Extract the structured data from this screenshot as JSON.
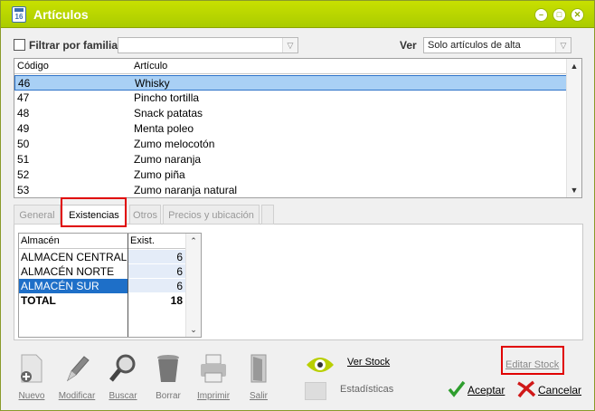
{
  "window": {
    "title": "Artículos",
    "icon_label": "16"
  },
  "filter": {
    "checkbox_label": "Filtrar por familia",
    "family_value": "",
    "ver_label": "Ver",
    "ver_value": "Solo artículos de alta"
  },
  "grid": {
    "headers": [
      "Código",
      "Artículo"
    ],
    "rows": [
      {
        "code": "46",
        "name": "Whisky"
      },
      {
        "code": "47",
        "name": "Pincho tortilla"
      },
      {
        "code": "48",
        "name": "Snack patatas"
      },
      {
        "code": "49",
        "name": "Menta poleo"
      },
      {
        "code": "50",
        "name": "Zumo melocotón"
      },
      {
        "code": "51",
        "name": "Zumo naranja"
      },
      {
        "code": "52",
        "name": "Zumo piña"
      },
      {
        "code": "53",
        "name": "Zumo naranja natural"
      }
    ],
    "selected_index": 0
  },
  "tabs": [
    "General",
    "Existencias",
    "Otros",
    "Precios y ubicación"
  ],
  "active_tab": 1,
  "stock": {
    "headers": [
      "Almacén",
      "Exist."
    ],
    "rows": [
      {
        "name": "ALMACEN CENTRAL",
        "qty": "6"
      },
      {
        "name": "ALMACÉN NORTE",
        "qty": "6"
      },
      {
        "name": "ALMACÉN SUR",
        "qty": "6"
      }
    ],
    "total_label": "TOTAL",
    "total_value": "18",
    "selected_index": 2
  },
  "toolbar": {
    "nuevo": "Nuevo",
    "modificar": "Modificar",
    "buscar": "Buscar",
    "borrar": "Borrar",
    "imprimir": "Imprimir",
    "salir": "Salir",
    "ver_stock": "Ver Stock",
    "estadisticas": "Estadísticas",
    "editar_stock": "Editar Stock",
    "aceptar": "Aceptar",
    "cancelar": "Cancelar"
  },
  "colors": {
    "titlebar": "#b2d400",
    "selection": "#a9d0f5",
    "highlight": "#e00000"
  }
}
